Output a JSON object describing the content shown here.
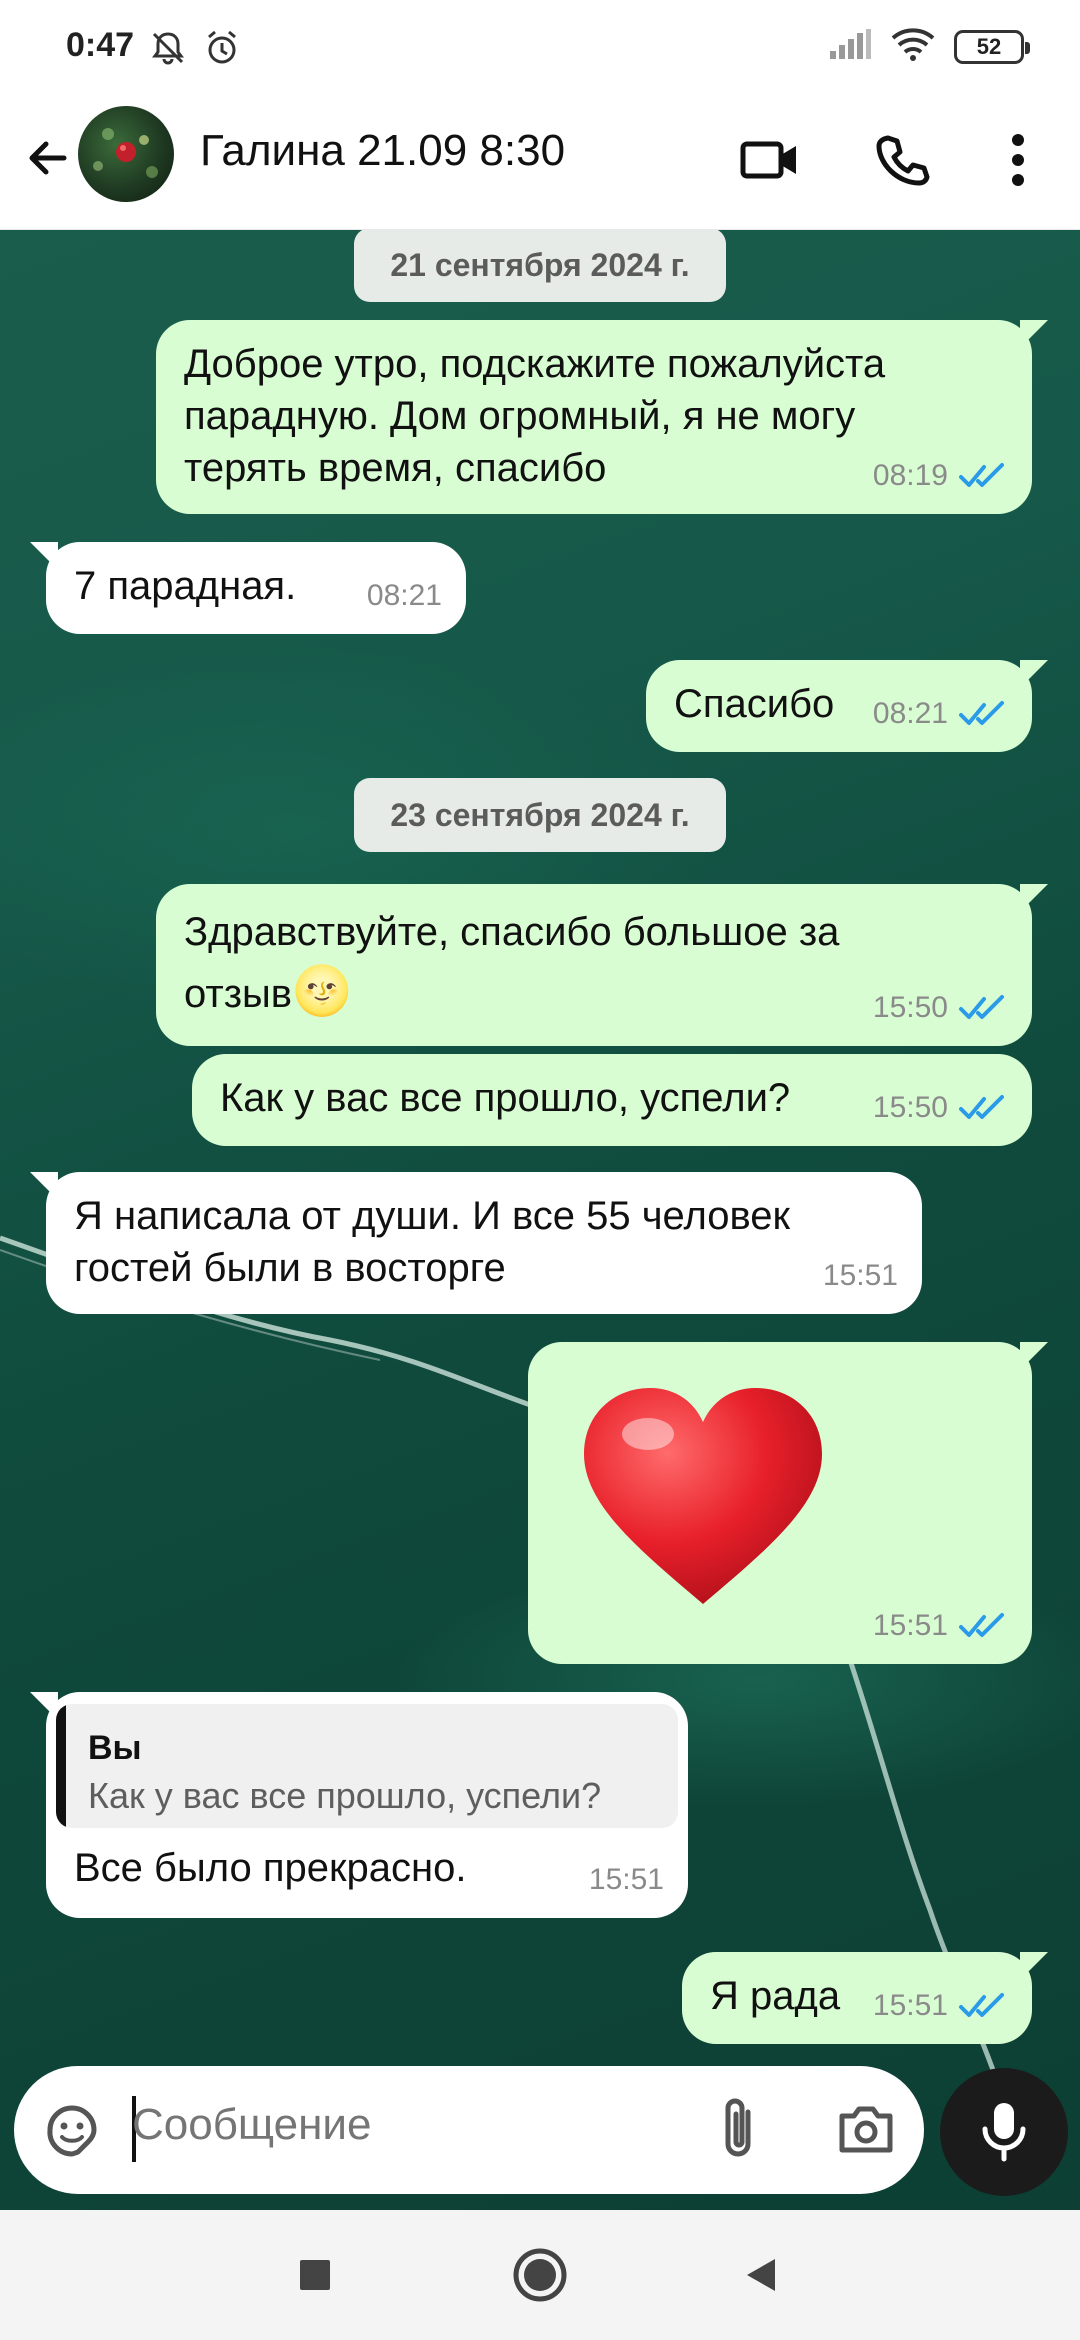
{
  "status_bar": {
    "time": "0:47",
    "battery": "52"
  },
  "header": {
    "contact_name": "Галина 21.09 8:30"
  },
  "chat": {
    "dates": [
      "21 сентября 2024 г.",
      "23 сентября 2024 г."
    ],
    "messages": [
      {
        "dir": "out",
        "lines": [
          "Доброе утро, подскажите пожалуйста",
          "парадную. Дом огромный, я не могу",
          "терять время, спасибо"
        ],
        "time": "08:19"
      },
      {
        "dir": "in",
        "lines": [
          "7 парадная."
        ],
        "time": "08:21"
      },
      {
        "dir": "out",
        "lines": [
          "Спасибо"
        ],
        "time": "08:21"
      },
      {
        "dir": "out",
        "lines": [
          "Здравствуйте, спасибо большое за",
          "отзыв"
        ],
        "emoji": "🌝",
        "time": "15:50"
      },
      {
        "dir": "out",
        "lines": [
          "Как у вас все прошло, успели?"
        ],
        "time": "15:50"
      },
      {
        "dir": "in",
        "lines": [
          "Я написала от души. И все 55 человек",
          "гостей были в восторге"
        ],
        "time": "15:51"
      },
      {
        "dir": "out",
        "emoji": "❤️",
        "time": "15:51"
      },
      {
        "dir": "in",
        "quote": {
          "author": "Вы",
          "text": "Как у вас все прошло, успели?"
        },
        "lines": [
          "Все было прекрасно."
        ],
        "time": "15:51"
      },
      {
        "dir": "out",
        "lines": [
          "Я рада"
        ],
        "time": "15:51"
      }
    ]
  },
  "composer": {
    "placeholder": "Сообщение"
  },
  "colors": {
    "outgoing_bubble": "#d9fdd3",
    "incoming_bubble": "#ffffff",
    "read_check": "#2a9be8"
  }
}
